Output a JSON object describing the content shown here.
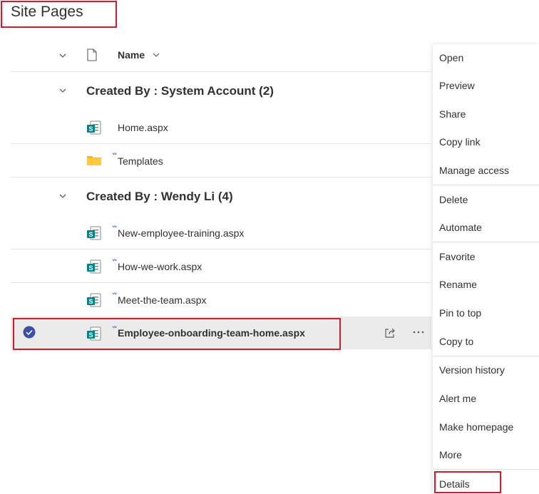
{
  "page": {
    "title": "Site Pages"
  },
  "header": {
    "name_label": "Name"
  },
  "groups": [
    {
      "title": "Created By : System Account (2)",
      "files": [
        {
          "name": "Home.aspx",
          "type": "sharepoint-page-icon"
        },
        {
          "name": "Templates",
          "type": "folder-icon"
        }
      ]
    },
    {
      "title": "Created By : Wendy Li (4)",
      "files": [
        {
          "name": "New-employee-training.aspx",
          "type": "sharepoint-page-icon"
        },
        {
          "name": "How-we-work.aspx",
          "type": "sharepoint-page-icon"
        },
        {
          "name": "Meet-the-team.aspx",
          "type": "sharepoint-page-icon"
        },
        {
          "name": "Employee-onboarding-team-home.aspx",
          "type": "sharepoint-page-icon",
          "selected": true
        }
      ]
    }
  ],
  "context_menu": {
    "items": [
      "Open",
      "Preview",
      "Share",
      "Copy link",
      "Manage access",
      "Delete",
      "Automate",
      "Favorite",
      "Rename",
      "Pin to top",
      "Copy to",
      "Version history",
      "Alert me",
      "Make homepage",
      "More",
      "Details"
    ]
  },
  "colors": {
    "highlight_border": "#d01c2a",
    "sharepoint_teal": "#038387",
    "folder_yellow": "#ffb900",
    "selected_bg": "#ebebeb",
    "check_blue": "#3b4fa5"
  }
}
